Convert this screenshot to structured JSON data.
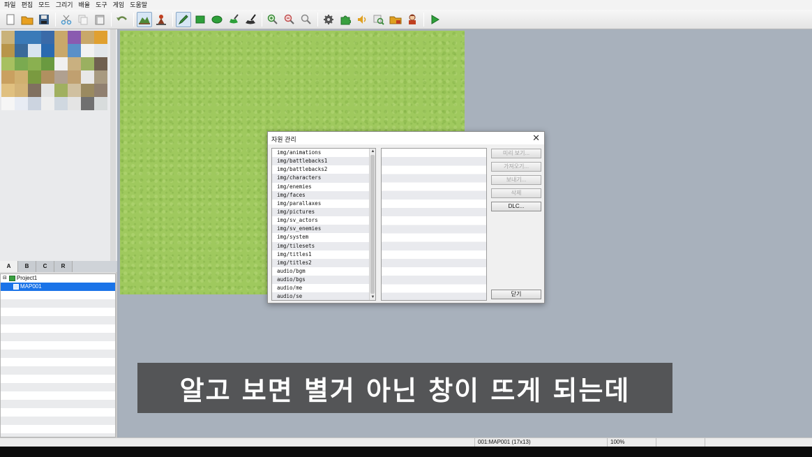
{
  "menu": [
    "파일",
    "편집",
    "모드",
    "그리기",
    "배율",
    "도구",
    "게임",
    "도움말"
  ],
  "toolbar": {
    "buttons": [
      {
        "icon": "new-project-icon",
        "color": "#ffffff"
      },
      {
        "icon": "open-project-icon",
        "color": "#e8a020"
      },
      {
        "icon": "save-project-icon",
        "color": "#3a6ea5"
      },
      {
        "icon": "cut-icon",
        "color": "#4a9ad0"
      },
      {
        "icon": "copy-icon",
        "color": "#d0d0d0"
      },
      {
        "icon": "paste-icon",
        "color": "#a0a0a0"
      },
      {
        "icon": "undo-icon",
        "color": "#5a8a3a"
      },
      {
        "icon": "map-mode-icon",
        "color": "#4f8a3a"
      },
      {
        "icon": "event-mode-icon",
        "color": "#c04020"
      },
      {
        "icon": "pencil-icon",
        "color": "#3c8c3c"
      },
      {
        "icon": "rectangle-icon",
        "color": "#2ea03a"
      },
      {
        "icon": "ellipse-icon",
        "color": "#2ea03a"
      },
      {
        "icon": "fill-icon",
        "color": "#2ea03a"
      },
      {
        "icon": "shadow-pen-icon",
        "color": "#333333"
      },
      {
        "icon": "zoom-in-icon",
        "color": "#3a8a3a"
      },
      {
        "icon": "zoom-out-icon",
        "color": "#c05050"
      },
      {
        "icon": "zoom-actual-icon",
        "color": "#888888"
      },
      {
        "icon": "database-icon",
        "color": "#555555"
      },
      {
        "icon": "plugin-manager-icon",
        "color": "#3aa040"
      },
      {
        "icon": "sound-test-icon",
        "color": "#e0a020"
      },
      {
        "icon": "event-searcher-icon",
        "color": "#3a8a3a"
      },
      {
        "icon": "resource-manager-icon",
        "color": "#e0a020"
      },
      {
        "icon": "character-generator-icon",
        "color": "#c04020"
      },
      {
        "icon": "playtest-icon",
        "color": "#2ea03a"
      }
    ]
  },
  "layer_tabs": [
    "A",
    "B",
    "C",
    "R"
  ],
  "map_tree": {
    "project": "Project1",
    "maps": [
      "MAP001"
    ]
  },
  "dialog": {
    "title": "자원 관리",
    "close": "✕",
    "folders": [
      "img/animations",
      "img/battlebacks1",
      "img/battlebacks2",
      "img/characters",
      "img/enemies",
      "img/faces",
      "img/parallaxes",
      "img/pictures",
      "img/sv_actors",
      "img/sv_enemies",
      "img/system",
      "img/tilesets",
      "img/titles1",
      "img/titles2",
      "audio/bgm",
      "audio/bgs",
      "audio/me",
      "audio/se"
    ],
    "buttons": [
      {
        "label": "미리 보기...",
        "enabled": false
      },
      {
        "label": "가져오기...",
        "enabled": false
      },
      {
        "label": "보내기...",
        "enabled": false
      },
      {
        "label": "삭제",
        "enabled": false
      },
      {
        "label": "DLC...",
        "enabled": true
      }
    ],
    "close_button": "닫기"
  },
  "status": {
    "map_info": "001:MAP001 (17x13)",
    "zoom": "100%"
  },
  "caption": "알고 보면 별거 아닌 창이 뜨게 되는데",
  "colors": {
    "grass": "#9fc95e",
    "workspace": "#a8b1bc",
    "selection": "#1a73e8"
  }
}
